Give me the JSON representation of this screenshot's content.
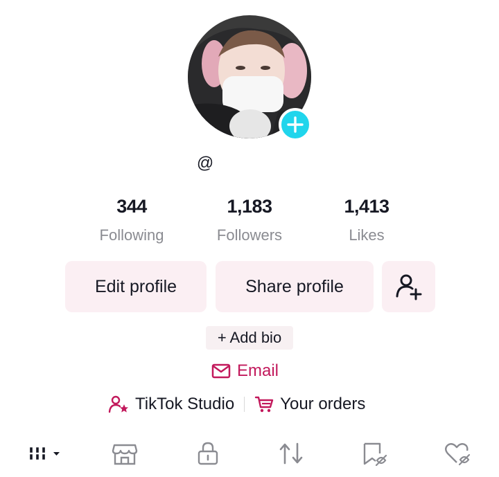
{
  "profile": {
    "handle": "@",
    "avatar_badge_icon": "plus-icon"
  },
  "stats": [
    {
      "value": "344",
      "label": "Following"
    },
    {
      "value": "1,183",
      "label": "Followers"
    },
    {
      "value": "1,413",
      "label": "Likes"
    }
  ],
  "actions": {
    "edit_profile": "Edit profile",
    "share_profile": "Share profile",
    "add_friend_icon": "add-user-icon"
  },
  "bio": {
    "add_bio": "+ Add bio"
  },
  "contact": {
    "email": "Email",
    "email_icon": "envelope-icon"
  },
  "links": {
    "studio": "TikTok Studio",
    "studio_icon": "person-star-icon",
    "orders": "Your orders",
    "orders_icon": "cart-icon"
  },
  "tabs": [
    {
      "name": "videos-grid",
      "icon": "grid-icon"
    },
    {
      "name": "shop",
      "icon": "shop-icon"
    },
    {
      "name": "private",
      "icon": "lock-icon"
    },
    {
      "name": "reposts",
      "icon": "repost-icon"
    },
    {
      "name": "saved",
      "icon": "bookmark-hidden-icon"
    },
    {
      "name": "liked",
      "icon": "heart-hidden-icon"
    }
  ],
  "colors": {
    "accent_cyan": "#20d5ec",
    "email_pink": "#c2185b",
    "button_bg": "#fbeff3",
    "muted_text": "#8a8b91"
  }
}
